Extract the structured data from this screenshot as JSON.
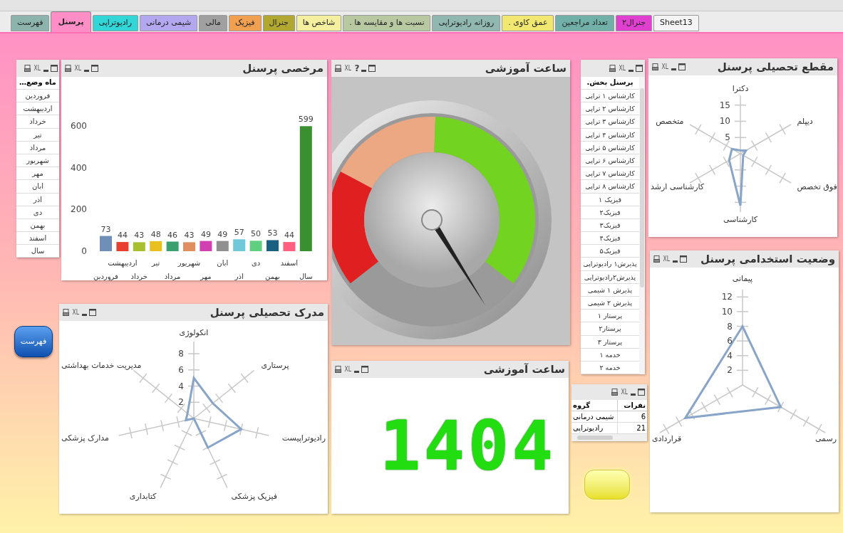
{
  "tabs": [
    {
      "label": "Sheet13",
      "color": "#f4f4f4",
      "selected": false
    },
    {
      "label": "جنرال۲",
      "color": "#e040d0",
      "selected": false
    },
    {
      "label": "تعداد مراجعین",
      "color": "#70b0a8",
      "selected": false
    },
    {
      "label": "عمق کاوی .",
      "color": "#f0e870",
      "selected": false
    },
    {
      "label": "روزانه رادیوتراپی",
      "color": "#90b8b0",
      "selected": false
    },
    {
      "label": "نسبت ها و مقایسه ها .",
      "color": "#b8c8a0",
      "selected": false
    },
    {
      "label": "شاخص ها",
      "color": "#f5f0a0",
      "selected": false
    },
    {
      "label": "جنرال",
      "color": "#b0a830",
      "selected": false
    },
    {
      "label": "فیزیک",
      "color": "#f0a050",
      "selected": false
    },
    {
      "label": "مالی",
      "color": "#a0a0a0",
      "selected": false
    },
    {
      "label": "شیمی درمانی",
      "color": "#b3a8f0",
      "selected": false
    },
    {
      "label": "رادیوتراپی",
      "color": "#33d6d6",
      "selected": false
    },
    {
      "label": "پرسنل",
      "color": "#ff8ec6",
      "selected": true
    },
    {
      "label": "فهرست",
      "color": "#8db3ad",
      "selected": false
    }
  ],
  "month_list": {
    "xl": "XL",
    "header": "ماه وضع…",
    "items": [
      "فروردین",
      "اردیبهشت",
      "خرداد",
      "تیر",
      "مرداد",
      "شهریور",
      "مهر",
      "ابان",
      "اذر",
      "دی",
      "بهمن",
      "اسفند",
      "سال"
    ]
  },
  "leave_chart": {
    "title": "مرخصی پرسنل",
    "xl": "XL",
    "chart_data": {
      "type": "bar",
      "categories": [
        "فروردین",
        "اردیبهشت",
        "خرداد",
        "تیر",
        "مرداد",
        "شهریور",
        "مهر",
        "ابان",
        "اذر",
        "دی",
        "بهمن",
        "اسفند",
        "سال"
      ],
      "values": [
        73,
        44,
        43,
        48,
        46,
        43,
        49,
        49,
        57,
        50,
        53,
        44,
        599
      ],
      "colors": [
        "#6f8fb8",
        "#e84030",
        "#a8c030",
        "#e8c020",
        "#3aa070",
        "#e09060",
        "#d040b0",
        "#909090",
        "#70c8d8",
        "#60d080",
        "#1a6080",
        "#ff6080",
        "#3a9030"
      ],
      "yticks": [
        0,
        200,
        400,
        600
      ],
      "ylim": [
        0,
        600
      ],
      "data_labels": true
    }
  },
  "training_gauge": {
    "title": "ساعت آموزشی",
    "xl": "XL",
    "help": "?"
  },
  "staff_list": {
    "xl": "XL",
    "header": "پرسنل بخش.",
    "items": [
      "کارشناس ۱ تراپی",
      "کارشناس ۲ تراپی",
      "کارشناس ۳ تراپی",
      "کارشناس ۴ تراپی",
      "کارشناس ۵ تراپی",
      "کارشناس ۶ تراپی",
      "کارشناس ۷ تراپی",
      "کارشناس ۸ تراپی",
      "فیزیک ۱",
      "فیزیک۲",
      "فیزیک۳",
      "فیزیک۴",
      "فیزیک۵",
      "پذیرش۱ رادیوتراپی",
      "پذیرش۲رادیوتراپی",
      "پذیرش ۱ شیمی",
      "پذیرش ۲ شیمی",
      "پرستار ۱",
      "پرستار۲",
      "پرستار ۳",
      "خدمه ۱",
      "خدمه ۲"
    ]
  },
  "degree_chart": {
    "title": "مقطع تحصیلی پرسنل",
    "xl": "XL",
    "axes": [
      "دکترا",
      "دیپلم",
      "متخصص",
      "فوق تخصص",
      "کارشناسی ارشد",
      "کارشناسی"
    ],
    "ticks": [
      "15",
      "10",
      "5"
    ]
  },
  "employment_chart": {
    "title": "وضعیت استخدامی پرسنل",
    "xl": "XL",
    "axes": [
      "پیمانی",
      "رسمی",
      "قراردادی"
    ],
    "ticks": [
      "12",
      "10",
      "8",
      "6",
      "4",
      "2"
    ]
  },
  "menu_button": {
    "label": "فهرست"
  },
  "field_chart": {
    "title": "مدرک تحصیلی پرسنل",
    "xl": "XL",
    "axes": [
      "انکولوژی",
      "پرستاری",
      "مدیریت خدمات بهداشتی",
      "رادیوتراپیست",
      "مدارک پزشکی",
      "فیزیک پزشکی",
      "کتابداری"
    ],
    "ticks": [
      "8",
      "6",
      "4",
      "2"
    ]
  },
  "training_clock": {
    "title": "ساعت آموزشی",
    "xl": "XL",
    "display": "1404"
  },
  "group_table": {
    "xl": "XL",
    "columns": [
      "نفرات",
      "گروه"
    ],
    "rows": [
      [
        "6",
        "شیمی درمانی"
      ],
      [
        "21",
        "رادیوتراپی"
      ]
    ]
  }
}
